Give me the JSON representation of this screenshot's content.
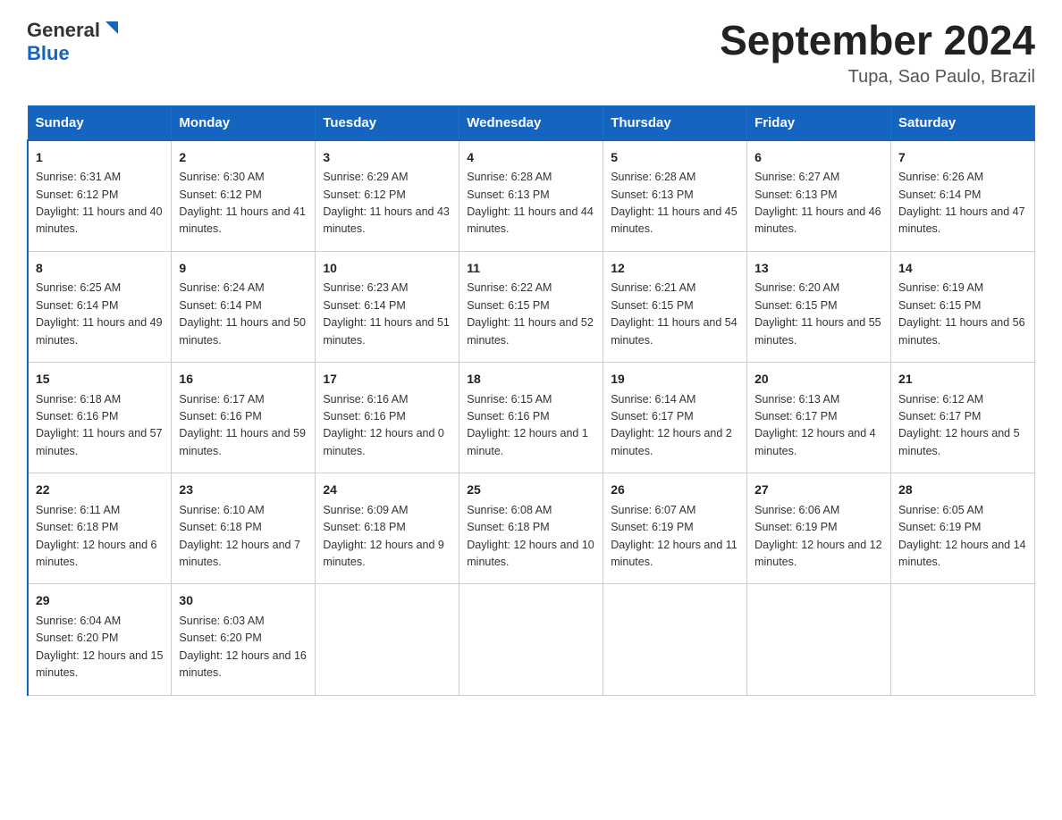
{
  "header": {
    "logo_general": "General",
    "logo_blue": "Blue",
    "month_year": "September 2024",
    "location": "Tupa, Sao Paulo, Brazil"
  },
  "calendar": {
    "days_of_week": [
      "Sunday",
      "Monday",
      "Tuesday",
      "Wednesday",
      "Thursday",
      "Friday",
      "Saturday"
    ],
    "weeks": [
      [
        {
          "day": "1",
          "sunrise": "Sunrise: 6:31 AM",
          "sunset": "Sunset: 6:12 PM",
          "daylight": "Daylight: 11 hours and 40 minutes."
        },
        {
          "day": "2",
          "sunrise": "Sunrise: 6:30 AM",
          "sunset": "Sunset: 6:12 PM",
          "daylight": "Daylight: 11 hours and 41 minutes."
        },
        {
          "day": "3",
          "sunrise": "Sunrise: 6:29 AM",
          "sunset": "Sunset: 6:12 PM",
          "daylight": "Daylight: 11 hours and 43 minutes."
        },
        {
          "day": "4",
          "sunrise": "Sunrise: 6:28 AM",
          "sunset": "Sunset: 6:13 PM",
          "daylight": "Daylight: 11 hours and 44 minutes."
        },
        {
          "day": "5",
          "sunrise": "Sunrise: 6:28 AM",
          "sunset": "Sunset: 6:13 PM",
          "daylight": "Daylight: 11 hours and 45 minutes."
        },
        {
          "day": "6",
          "sunrise": "Sunrise: 6:27 AM",
          "sunset": "Sunset: 6:13 PM",
          "daylight": "Daylight: 11 hours and 46 minutes."
        },
        {
          "day": "7",
          "sunrise": "Sunrise: 6:26 AM",
          "sunset": "Sunset: 6:14 PM",
          "daylight": "Daylight: 11 hours and 47 minutes."
        }
      ],
      [
        {
          "day": "8",
          "sunrise": "Sunrise: 6:25 AM",
          "sunset": "Sunset: 6:14 PM",
          "daylight": "Daylight: 11 hours and 49 minutes."
        },
        {
          "day": "9",
          "sunrise": "Sunrise: 6:24 AM",
          "sunset": "Sunset: 6:14 PM",
          "daylight": "Daylight: 11 hours and 50 minutes."
        },
        {
          "day": "10",
          "sunrise": "Sunrise: 6:23 AM",
          "sunset": "Sunset: 6:14 PM",
          "daylight": "Daylight: 11 hours and 51 minutes."
        },
        {
          "day": "11",
          "sunrise": "Sunrise: 6:22 AM",
          "sunset": "Sunset: 6:15 PM",
          "daylight": "Daylight: 11 hours and 52 minutes."
        },
        {
          "day": "12",
          "sunrise": "Sunrise: 6:21 AM",
          "sunset": "Sunset: 6:15 PM",
          "daylight": "Daylight: 11 hours and 54 minutes."
        },
        {
          "day": "13",
          "sunrise": "Sunrise: 6:20 AM",
          "sunset": "Sunset: 6:15 PM",
          "daylight": "Daylight: 11 hours and 55 minutes."
        },
        {
          "day": "14",
          "sunrise": "Sunrise: 6:19 AM",
          "sunset": "Sunset: 6:15 PM",
          "daylight": "Daylight: 11 hours and 56 minutes."
        }
      ],
      [
        {
          "day": "15",
          "sunrise": "Sunrise: 6:18 AM",
          "sunset": "Sunset: 6:16 PM",
          "daylight": "Daylight: 11 hours and 57 minutes."
        },
        {
          "day": "16",
          "sunrise": "Sunrise: 6:17 AM",
          "sunset": "Sunset: 6:16 PM",
          "daylight": "Daylight: 11 hours and 59 minutes."
        },
        {
          "day": "17",
          "sunrise": "Sunrise: 6:16 AM",
          "sunset": "Sunset: 6:16 PM",
          "daylight": "Daylight: 12 hours and 0 minutes."
        },
        {
          "day": "18",
          "sunrise": "Sunrise: 6:15 AM",
          "sunset": "Sunset: 6:16 PM",
          "daylight": "Daylight: 12 hours and 1 minute."
        },
        {
          "day": "19",
          "sunrise": "Sunrise: 6:14 AM",
          "sunset": "Sunset: 6:17 PM",
          "daylight": "Daylight: 12 hours and 2 minutes."
        },
        {
          "day": "20",
          "sunrise": "Sunrise: 6:13 AM",
          "sunset": "Sunset: 6:17 PM",
          "daylight": "Daylight: 12 hours and 4 minutes."
        },
        {
          "day": "21",
          "sunrise": "Sunrise: 6:12 AM",
          "sunset": "Sunset: 6:17 PM",
          "daylight": "Daylight: 12 hours and 5 minutes."
        }
      ],
      [
        {
          "day": "22",
          "sunrise": "Sunrise: 6:11 AM",
          "sunset": "Sunset: 6:18 PM",
          "daylight": "Daylight: 12 hours and 6 minutes."
        },
        {
          "day": "23",
          "sunrise": "Sunrise: 6:10 AM",
          "sunset": "Sunset: 6:18 PM",
          "daylight": "Daylight: 12 hours and 7 minutes."
        },
        {
          "day": "24",
          "sunrise": "Sunrise: 6:09 AM",
          "sunset": "Sunset: 6:18 PM",
          "daylight": "Daylight: 12 hours and 9 minutes."
        },
        {
          "day": "25",
          "sunrise": "Sunrise: 6:08 AM",
          "sunset": "Sunset: 6:18 PM",
          "daylight": "Daylight: 12 hours and 10 minutes."
        },
        {
          "day": "26",
          "sunrise": "Sunrise: 6:07 AM",
          "sunset": "Sunset: 6:19 PM",
          "daylight": "Daylight: 12 hours and 11 minutes."
        },
        {
          "day": "27",
          "sunrise": "Sunrise: 6:06 AM",
          "sunset": "Sunset: 6:19 PM",
          "daylight": "Daylight: 12 hours and 12 minutes."
        },
        {
          "day": "28",
          "sunrise": "Sunrise: 6:05 AM",
          "sunset": "Sunset: 6:19 PM",
          "daylight": "Daylight: 12 hours and 14 minutes."
        }
      ],
      [
        {
          "day": "29",
          "sunrise": "Sunrise: 6:04 AM",
          "sunset": "Sunset: 6:20 PM",
          "daylight": "Daylight: 12 hours and 15 minutes."
        },
        {
          "day": "30",
          "sunrise": "Sunrise: 6:03 AM",
          "sunset": "Sunset: 6:20 PM",
          "daylight": "Daylight: 12 hours and 16 minutes."
        },
        {
          "day": "",
          "sunrise": "",
          "sunset": "",
          "daylight": ""
        },
        {
          "day": "",
          "sunrise": "",
          "sunset": "",
          "daylight": ""
        },
        {
          "day": "",
          "sunrise": "",
          "sunset": "",
          "daylight": ""
        },
        {
          "day": "",
          "sunrise": "",
          "sunset": "",
          "daylight": ""
        },
        {
          "day": "",
          "sunrise": "",
          "sunset": "",
          "daylight": ""
        }
      ]
    ]
  }
}
